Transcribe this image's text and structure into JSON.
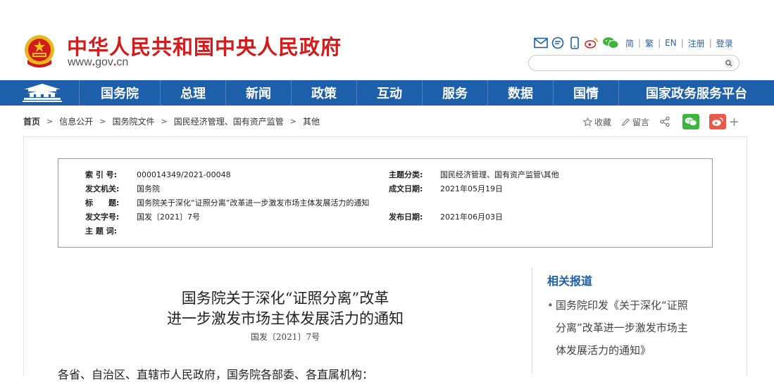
{
  "header": {
    "site_title": "中华人民共和国中央人民政府",
    "site_url_pre": "www",
    "site_url_mid": "gov",
    "site_url_post": "cn",
    "lang_links": [
      "简",
      "繁",
      "EN",
      "注册",
      "登录"
    ],
    "search": {
      "placeholder": ""
    }
  },
  "nav": {
    "items": [
      "国务院",
      "总理",
      "新闻",
      "政策",
      "互动",
      "服务",
      "数据",
      "国情",
      "国家政务服务平台"
    ]
  },
  "breadcrumb": {
    "items": [
      "首页",
      "信息公开",
      "国务院文件",
      "国民经济管理、国有资产监管",
      "其他"
    ],
    "favorite_label": "收藏",
    "comment_label": "留言"
  },
  "info": {
    "index_label": "索 引 号:",
    "index_value": "000014349/2021-00048",
    "category_label": "主题分类:",
    "category_value": "国民经济管理、国有资产监管\\其他",
    "issuer_label": "发文机关:",
    "issuer_value": "国务院",
    "written_label": "成文日期:",
    "written_value": "2021年05月19日",
    "title_label": "标　　题:",
    "title_value": "国务院关于深化“证照分离”改革进一步激发市场主体发展活力的通知",
    "docno_label": "发文字号:",
    "docno_value": "国发〔2021〕7号",
    "published_label": "发布日期:",
    "published_value": "2021年06月03日",
    "keywords_label": "主 题 词:",
    "keywords_value": ""
  },
  "article": {
    "title_line1": "国务院关于深化“证照分离”改革",
    "title_line2": "进一步激发市场主体发展活力的通知",
    "doc_number": "国发〔2021〕7号",
    "body_first_line": "各省、自治区、直辖市人民政府，国务院各部委、各直属机构："
  },
  "sidebar": {
    "title": "相关报道",
    "item_line1": "国务院印发《关于深化“证照",
    "item_line2": "分离”改革进一步激发市场主",
    "item_line3": "体发展活力的通知》"
  },
  "colors": {
    "brand_red": "#d21b1b",
    "nav_blue": "#1d5faa",
    "wechat_green": "#3fb53f",
    "weibo_red": "#e8594a"
  }
}
